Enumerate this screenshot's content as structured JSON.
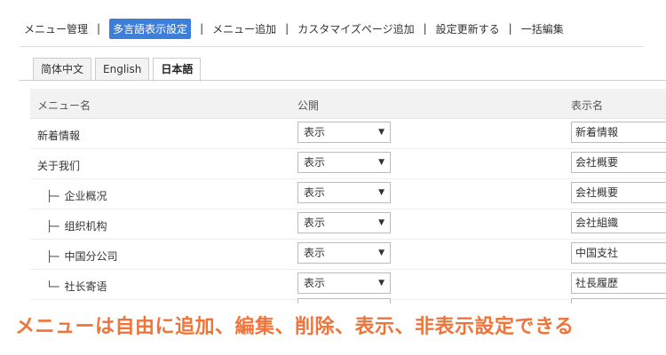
{
  "nav": {
    "items": [
      "メニュー管理",
      "多言語表示設定",
      "メニュー追加",
      "カスタマイズページ追加",
      "設定更新する",
      "一括編集"
    ],
    "active_index": 1,
    "separator": "|"
  },
  "tabs": [
    "简体中文",
    "English",
    "日本語"
  ],
  "active_tab": 2,
  "table": {
    "headers": {
      "menu_name": "メニュー名",
      "publish": "公開",
      "display_name": "表示名"
    },
    "rows": [
      {
        "tree": "",
        "name": "新着情報",
        "publish": "表示",
        "display": "新着情報"
      },
      {
        "tree": "",
        "name": "关于我们",
        "publish": "表示",
        "display": "会社概要"
      },
      {
        "tree": "├─",
        "name": "企业概况",
        "publish": "表示",
        "display": "会社概要"
      },
      {
        "tree": "├─",
        "name": "组织机构",
        "publish": "表示",
        "display": "会社組織"
      },
      {
        "tree": "├─",
        "name": "中国分公司",
        "publish": "表示",
        "display": "中国支社"
      },
      {
        "tree": "└─",
        "name": "社长寄语",
        "publish": "表示",
        "display": "社長履歴"
      }
    ],
    "dropdown_arrow": "▼"
  },
  "caption": "メニューは自由に追加、編集、削除、表示、非表示設定できる",
  "colors": {
    "accent": "#3d7ed9",
    "caption": "#f0743a"
  }
}
